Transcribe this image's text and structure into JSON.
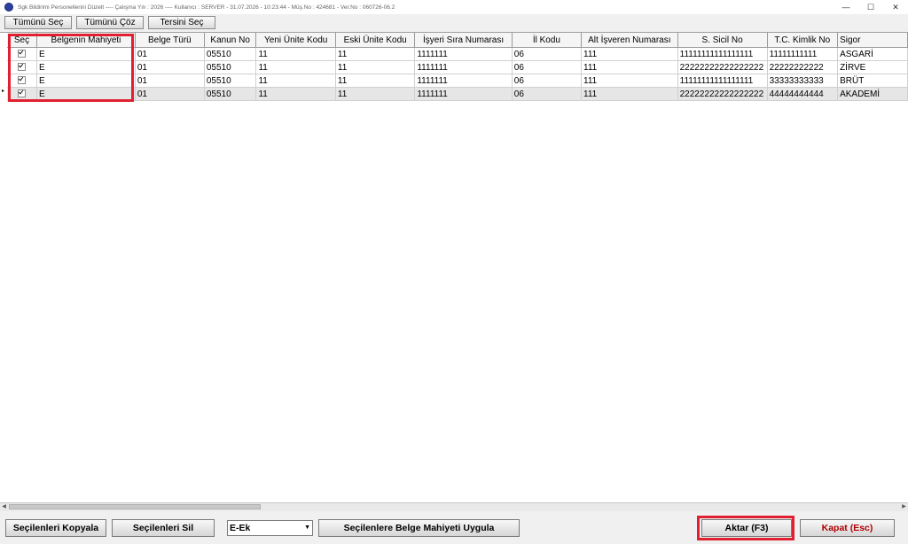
{
  "window": {
    "title": "Sgk Bildirimi Personellerini Düzelt  ----  Çalışma Yılı : 2026  ----  Kullanıcı : SERVER - 31.07.2026 - 10:23:44 - Müş.No : 424681 - Ver.No : 060726-06.2",
    "minimize": "—",
    "maximize": "☐",
    "close": "✕"
  },
  "toolbar": {
    "select_all": "Tümünü Seç",
    "deselect_all": "Tümünü Çöz",
    "invert": "Tersini Seç"
  },
  "table": {
    "columns": [
      "Seç",
      "Belgenin Mahiyeti",
      "Belge Türü",
      "Kanun No",
      "Yeni Ünite Kodu",
      "Eski Ünite Kodu",
      "İşyeri Sıra Numarası",
      "İl Kodu",
      "Alt İşveren Numarası",
      "S. Sicil No",
      "T.C. Kimlik No",
      "Sigor"
    ],
    "current_row_marker": "▸",
    "rows": [
      {
        "checked": true,
        "cells": [
          "E",
          "01",
          "05510",
          "11",
          "11",
          "1111111",
          "06",
          "111",
          "11111111111111111",
          "11111111111",
          "ASGARİ"
        ]
      },
      {
        "checked": true,
        "cells": [
          "E",
          "01",
          "05510",
          "11",
          "11",
          "1111111",
          "06",
          "111",
          "22222222222222222",
          "22222222222",
          "ZİRVE"
        ]
      },
      {
        "checked": true,
        "cells": [
          "E",
          "01",
          "05510",
          "11",
          "11",
          "1111111",
          "06",
          "111",
          "11111111111111111",
          "33333333333",
          "BRÜT"
        ]
      },
      {
        "checked": true,
        "cells": [
          "E",
          "01",
          "05510",
          "11",
          "11",
          "1111111",
          "06",
          "111",
          "22222222222222222",
          "44444444444",
          "AKADEMİ"
        ]
      }
    ]
  },
  "scrollbar": {
    "left_arrow": "◀",
    "right_arrow": "▶"
  },
  "bottom": {
    "copy_selected": "Seçilenleri Kopyala",
    "delete_selected": "Seçilenleri Sil",
    "combo_value": "E-Ek",
    "combo_arrow": "▼",
    "apply_nature": "Seçilenlere Belge Mahiyeti Uygula",
    "transfer": "Aktar (F3)",
    "close": "Kapat (Esc)"
  },
  "colors": {
    "highlight": "#e02030",
    "close_text": "#b00000"
  }
}
